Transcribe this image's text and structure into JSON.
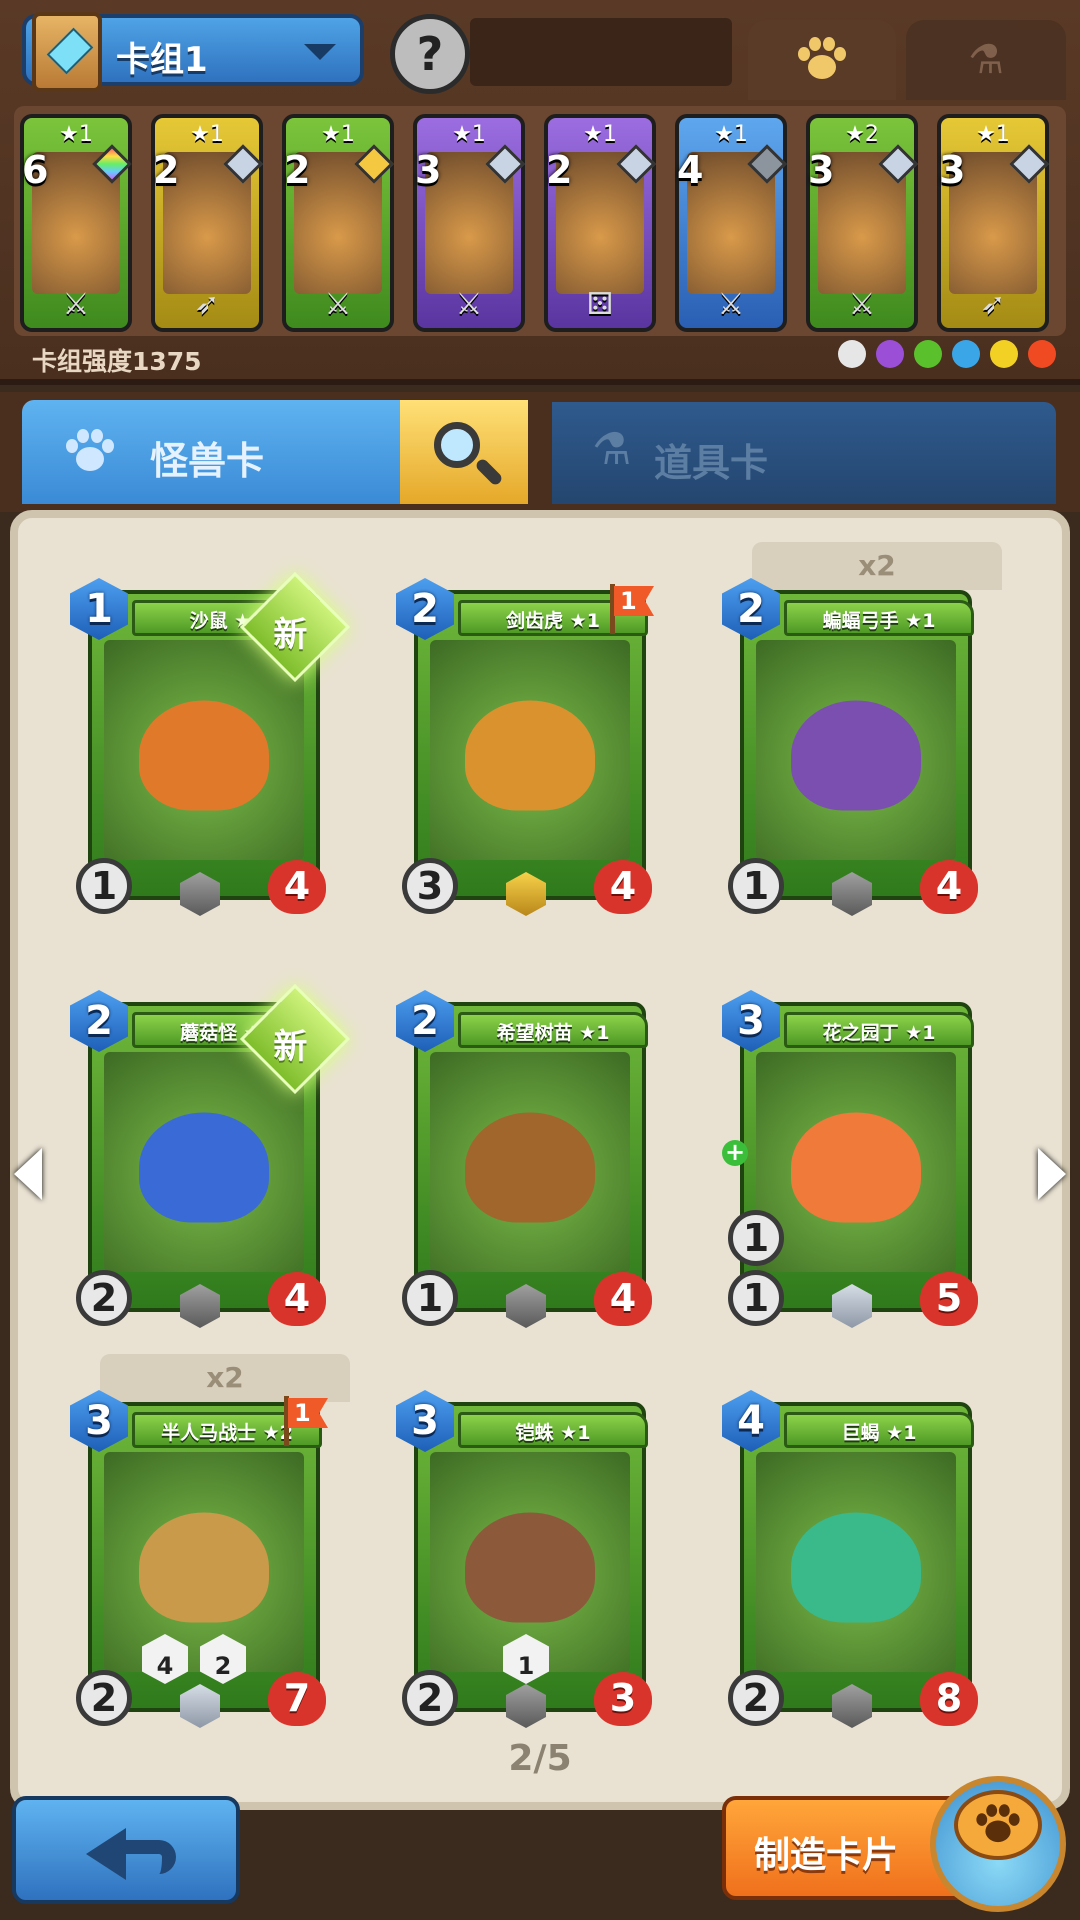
{
  "deck": {
    "name": "卡组1",
    "power_label": "卡组强度1375",
    "cards": [
      {
        "cost": "6",
        "stars": "★1",
        "color": "green",
        "type_icon": "sword-icon",
        "gem": "prism"
      },
      {
        "cost": "2",
        "stars": "★1",
        "color": "yellow",
        "type_icon": "bow-icon",
        "gem": "silver"
      },
      {
        "cost": "2",
        "stars": "★1",
        "color": "green",
        "type_icon": "sword-icon",
        "gem": "gold"
      },
      {
        "cost": "3",
        "stars": "★1",
        "color": "purple",
        "type_icon": "sword-icon",
        "gem": "silver"
      },
      {
        "cost": "2",
        "stars": "★1",
        "color": "purple",
        "type_icon": "dice-icon",
        "gem": "silver"
      },
      {
        "cost": "4",
        "stars": "★1",
        "color": "blue",
        "type_icon": "sword-icon",
        "gem": "gray"
      },
      {
        "cost": "3",
        "stars": "★2",
        "color": "green",
        "type_icon": "sword-icon",
        "gem": "silver"
      },
      {
        "cost": "3",
        "stars": "★1",
        "color": "yellow",
        "type_icon": "bow-icon",
        "gem": "silver"
      }
    ],
    "element_colors": [
      "#e6e6e6",
      "#9b4fd6",
      "#5ac02c",
      "#3aa6e8",
      "#f2d024",
      "#ef4a22"
    ]
  },
  "tabs": {
    "monster": "怪兽卡",
    "item": "道具卡"
  },
  "cards": [
    {
      "name": "沙鼠 ★1",
      "cost": "1",
      "atk": "1",
      "hp": "4",
      "rarity": "gray",
      "badge_new": "新",
      "art": "#e07a2a"
    },
    {
      "name": "剑齿虎 ★1",
      "cost": "2",
      "atk": "3",
      "hp": "4",
      "rarity": "gold",
      "flag": "1",
      "art": "#d9922e"
    },
    {
      "name": "蝙蝠弓手 ★1",
      "cost": "2",
      "atk": "1",
      "hp": "4",
      "rarity": "gray",
      "dup": "x2",
      "art": "#7a4fb0"
    },
    {
      "name": "蘑菇怪 ★1",
      "cost": "2",
      "atk": "2",
      "hp": "4",
      "rarity": "gray",
      "badge_new": "新",
      "art": "#3a6ad6"
    },
    {
      "name": "希望树苗 ★1",
      "cost": "2",
      "atk": "1",
      "hp": "4",
      "rarity": "gray",
      "art": "#a0662c"
    },
    {
      "name": "花之园丁 ★1",
      "cost": "3",
      "atk": "1",
      "hp": "5",
      "rarity": "silver",
      "heal": "1",
      "art": "#ef7a3a"
    },
    {
      "name": "半人马战士 ★2",
      "cost": "3",
      "atk": "2",
      "hp": "7",
      "rarity": "silver",
      "flag": "1",
      "dup": "x2",
      "equip": [
        "4",
        "2"
      ],
      "art": "#c89a4a"
    },
    {
      "name": "铠蛛 ★1",
      "cost": "3",
      "atk": "2",
      "hp": "3",
      "rarity": "gray",
      "equip": [
        "1"
      ],
      "art": "#8c5a3a"
    },
    {
      "name": "巨蝎 ★1",
      "cost": "4",
      "atk": "2",
      "hp": "8",
      "rarity": "gray",
      "art": "#3ab98a"
    }
  ],
  "pager": "2/5",
  "buttons": {
    "craft": "制造卡片"
  }
}
